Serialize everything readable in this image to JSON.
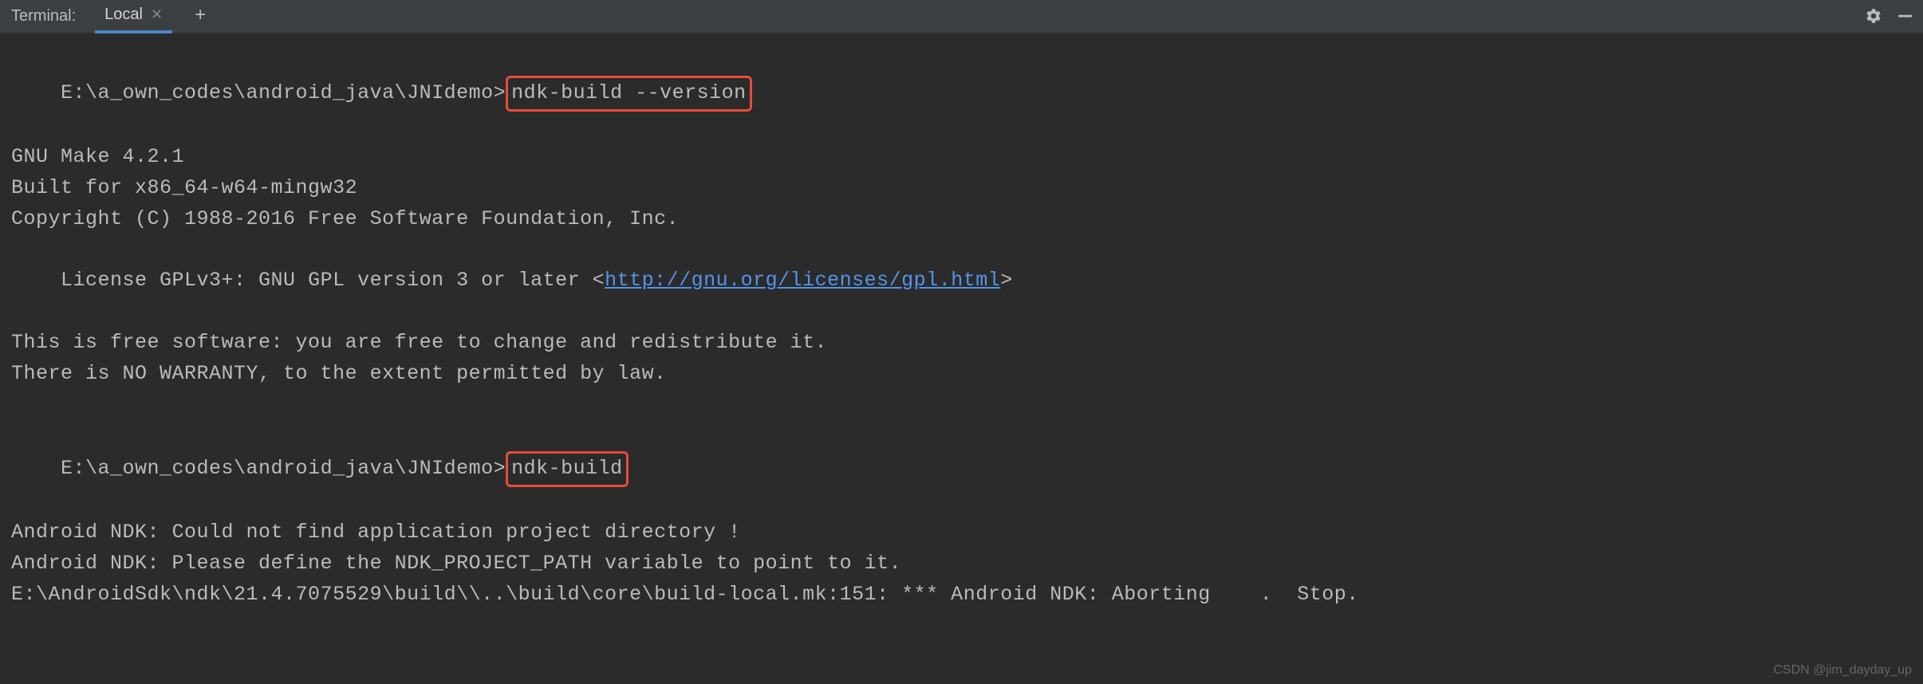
{
  "header": {
    "label": "Terminal:",
    "tab_name": "Local"
  },
  "terminal": {
    "prompt1": "E:\\a_own_codes\\android_java\\JNIdemo>",
    "cmd1": "ndk-build --version",
    "out1_line1": "GNU Make 4.2.1",
    "out1_line2": "Built for x86_64-w64-mingw32",
    "out1_line3": "Copyright (C) 1988-2016 Free Software Foundation, Inc.",
    "out1_line4_pre": "License GPLv3+: GNU GPL version 3 or later <",
    "out1_line4_link": "http://gnu.org/licenses/gpl.html",
    "out1_line4_post": ">",
    "out1_line5": "This is free software: you are free to change and redistribute it.",
    "out1_line6": "There is NO WARRANTY, to the extent permitted by law.",
    "prompt2": "E:\\a_own_codes\\android_java\\JNIdemo>",
    "cmd2": "ndk-build",
    "out2_line1": "Android NDK: Could not find application project directory !",
    "out2_line2": "Android NDK: Please define the NDK_PROJECT_PATH variable to point to it.",
    "out2_line3": "E:\\AndroidSdk\\ndk\\21.4.7075529\\build\\\\..\\build\\core\\build-local.mk:151: *** Android NDK: Aborting    .  Stop."
  },
  "watermark": "CSDN @jim_dayday_up"
}
